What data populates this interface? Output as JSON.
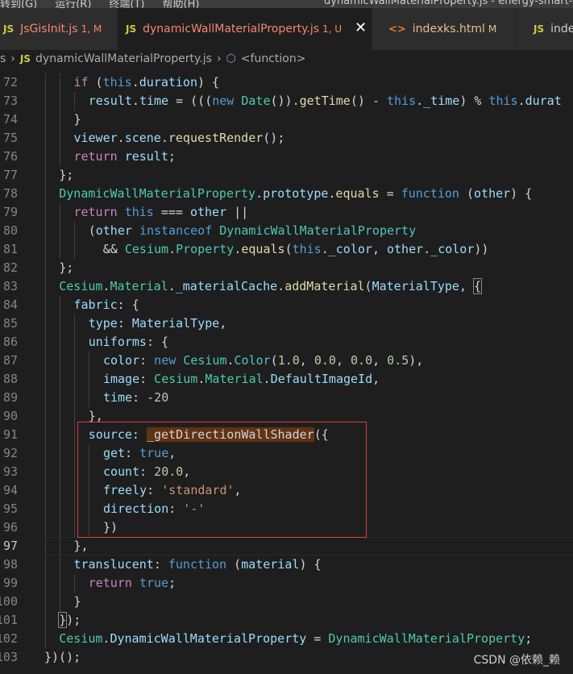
{
  "menubar": {
    "items": [
      "转到(G)",
      "运行(R)",
      "终端(T)",
      "帮助(H)"
    ],
    "window_title": "dynamicWallMaterialProperty.js - energy-smart-s"
  },
  "tabs": [
    {
      "icon": "JS",
      "name": "JsGisInit.js",
      "badge": "1, M",
      "state": "error"
    },
    {
      "icon": "JS",
      "name": "dynamicWallMaterialProperty.js",
      "badge": "1, U",
      "state": "active"
    },
    {
      "icon": "<>",
      "name": "indexks.html",
      "badge": "M",
      "state": "modified"
    },
    {
      "icon": "JS",
      "name": "inde",
      "badge": "",
      "state": "normal"
    }
  ],
  "breadcrumb": {
    "parts": [
      "s",
      "dynamicWallMaterialProperty.js",
      "<function>"
    ],
    "js_icon": "JS"
  },
  "code_lines": [
    {
      "n": "72",
      "indent": [
        1,
        2
      ],
      "tokens": [
        [
          "t-ctl",
          "if"
        ],
        [
          "t-p",
          " ("
        ],
        [
          "t-kw",
          "this"
        ],
        [
          "t-p",
          "."
        ],
        [
          "t-var",
          "duration"
        ],
        [
          "t-p",
          ") {"
        ]
      ]
    },
    {
      "n": "73",
      "indent": [
        1,
        2,
        3
      ],
      "tokens": [
        [
          "t-var",
          "result"
        ],
        [
          "t-p",
          "."
        ],
        [
          "t-var",
          "time"
        ],
        [
          "t-p",
          " = ((("
        ],
        [
          "t-kw",
          "new"
        ],
        [
          "t-p",
          " "
        ],
        [
          "t-cls",
          "Date"
        ],
        [
          "t-p",
          "())."
        ],
        [
          "t-fn",
          "getTime"
        ],
        [
          "t-p",
          "() - "
        ],
        [
          "t-kw",
          "this"
        ],
        [
          "t-p",
          "."
        ],
        [
          "t-var",
          "_time"
        ],
        [
          "t-p",
          ") % "
        ],
        [
          "t-kw",
          "this"
        ],
        [
          "t-p",
          "."
        ],
        [
          "t-var",
          "durat"
        ]
      ]
    },
    {
      "n": "74",
      "indent": [
        1,
        2
      ],
      "tokens": [
        [
          "t-p",
          "}"
        ]
      ]
    },
    {
      "n": "75",
      "indent": [
        1,
        2
      ],
      "tokens": [
        [
          "t-var",
          "viewer"
        ],
        [
          "t-p",
          "."
        ],
        [
          "t-var",
          "scene"
        ],
        [
          "t-p",
          "."
        ],
        [
          "t-fn",
          "requestRender"
        ],
        [
          "t-p",
          "();"
        ]
      ]
    },
    {
      "n": "76",
      "indent": [
        1,
        2
      ],
      "tokens": [
        [
          "t-ctl",
          "return"
        ],
        [
          "t-p",
          " "
        ],
        [
          "t-var",
          "result"
        ],
        [
          "t-p",
          ";"
        ]
      ]
    },
    {
      "n": "77",
      "indent": [
        1
      ],
      "tokens": [
        [
          "t-p",
          "};"
        ]
      ]
    },
    {
      "n": "78",
      "indent": [
        1
      ],
      "tokens": [
        [
          "t-cls",
          "DynamicWallMaterialProperty"
        ],
        [
          "t-p",
          "."
        ],
        [
          "t-var",
          "prototype"
        ],
        [
          "t-p",
          "."
        ],
        [
          "t-fn",
          "equals"
        ],
        [
          "t-p",
          " = "
        ],
        [
          "t-kw",
          "function"
        ],
        [
          "t-p",
          " ("
        ],
        [
          "t-var",
          "other"
        ],
        [
          "t-p",
          ") {"
        ]
      ]
    },
    {
      "n": "79",
      "indent": [
        1,
        2
      ],
      "tokens": [
        [
          "t-ctl",
          "return"
        ],
        [
          "t-p",
          " "
        ],
        [
          "t-kw",
          "this"
        ],
        [
          "t-p",
          " === "
        ],
        [
          "t-var",
          "other"
        ],
        [
          "t-p",
          " ||"
        ]
      ]
    },
    {
      "n": "80",
      "indent": [
        1,
        2,
        3
      ],
      "tokens": [
        [
          "t-p",
          "("
        ],
        [
          "t-var",
          "other"
        ],
        [
          "t-p",
          " "
        ],
        [
          "t-kw",
          "instanceof"
        ],
        [
          "t-p",
          " "
        ],
        [
          "t-cls",
          "DynamicWallMaterialProperty"
        ]
      ]
    },
    {
      "n": "81",
      "indent": [
        1,
        2,
        3
      ],
      "tokens": [
        [
          "t-p",
          "  && "
        ],
        [
          "t-cls",
          "Cesium"
        ],
        [
          "t-p",
          "."
        ],
        [
          "t-cls",
          "Property"
        ],
        [
          "t-p",
          "."
        ],
        [
          "t-fn",
          "equals"
        ],
        [
          "t-p",
          "("
        ],
        [
          "t-kw",
          "this"
        ],
        [
          "t-p",
          "."
        ],
        [
          "t-var",
          "_color"
        ],
        [
          "t-p",
          ", "
        ],
        [
          "t-var",
          "other"
        ],
        [
          "t-p",
          "."
        ],
        [
          "t-var",
          "_color"
        ],
        [
          "t-p",
          "))"
        ]
      ]
    },
    {
      "n": "82",
      "indent": [
        1
      ],
      "tokens": [
        [
          "t-p",
          "};"
        ]
      ]
    },
    {
      "n": "83",
      "indent": [
        1
      ],
      "tokens": [
        [
          "t-cls",
          "Cesium"
        ],
        [
          "t-p",
          "."
        ],
        [
          "t-cls",
          "Material"
        ],
        [
          "t-p",
          "."
        ],
        [
          "t-var",
          "_materialCache"
        ],
        [
          "t-p",
          "."
        ],
        [
          "t-fn",
          "addMaterial"
        ],
        [
          "t-p",
          "("
        ],
        [
          "t-var",
          "MaterialType"
        ],
        [
          "t-p",
          ", "
        ],
        [
          "t-br",
          "{"
        ]
      ]
    },
    {
      "n": "84",
      "indent": [
        1,
        2
      ],
      "tokens": [
        [
          "t-var",
          "fabric"
        ],
        [
          "t-p",
          ": {"
        ]
      ]
    },
    {
      "n": "85",
      "indent": [
        1,
        2,
        3
      ],
      "tokens": [
        [
          "t-var",
          "type"
        ],
        [
          "t-p",
          ": "
        ],
        [
          "t-var",
          "MaterialType"
        ],
        [
          "t-p",
          ","
        ]
      ]
    },
    {
      "n": "86",
      "indent": [
        1,
        2,
        3
      ],
      "tokens": [
        [
          "t-var",
          "uniforms"
        ],
        [
          "t-p",
          ": {"
        ]
      ]
    },
    {
      "n": "87",
      "indent": [
        1,
        2,
        3,
        4
      ],
      "tokens": [
        [
          "t-var",
          "color"
        ],
        [
          "t-p",
          ": "
        ],
        [
          "t-kw",
          "new"
        ],
        [
          "t-p",
          " "
        ],
        [
          "t-cls",
          "Cesium"
        ],
        [
          "t-p",
          "."
        ],
        [
          "t-cls",
          "Color"
        ],
        [
          "t-p",
          "("
        ],
        [
          "t-num",
          "1.0"
        ],
        [
          "t-p",
          ", "
        ],
        [
          "t-num",
          "0.0"
        ],
        [
          "t-p",
          ", "
        ],
        [
          "t-num",
          "0.0"
        ],
        [
          "t-p",
          ", "
        ],
        [
          "t-num",
          "0.5"
        ],
        [
          "t-p",
          "),"
        ]
      ]
    },
    {
      "n": "88",
      "indent": [
        1,
        2,
        3,
        4
      ],
      "tokens": [
        [
          "t-var",
          "image"
        ],
        [
          "t-p",
          ": "
        ],
        [
          "t-cls",
          "Cesium"
        ],
        [
          "t-p",
          "."
        ],
        [
          "t-cls",
          "Material"
        ],
        [
          "t-p",
          "."
        ],
        [
          "t-var",
          "DefaultImageId"
        ],
        [
          "t-p",
          ","
        ]
      ]
    },
    {
      "n": "89",
      "indent": [
        1,
        2,
        3,
        4
      ],
      "tokens": [
        [
          "t-var",
          "time"
        ],
        [
          "t-p",
          ": -"
        ],
        [
          "t-num",
          "20"
        ]
      ]
    },
    {
      "n": "90",
      "indent": [
        1,
        2,
        3
      ],
      "tokens": [
        [
          "t-p",
          "},"
        ]
      ]
    },
    {
      "n": "91",
      "indent": [
        1,
        2,
        3
      ],
      "tokens": [
        [
          "t-var",
          "source"
        ],
        [
          "t-p",
          ": "
        ],
        [
          "t-sel",
          "_getDirectionWallShader"
        ],
        [
          "t-p",
          "({"
        ]
      ]
    },
    {
      "n": "92",
      "indent": [
        1,
        2,
        3,
        4
      ],
      "tokens": [
        [
          "t-var",
          "get"
        ],
        [
          "t-p",
          ": "
        ],
        [
          "t-kw",
          "true"
        ],
        [
          "t-p",
          ","
        ]
      ]
    },
    {
      "n": "93",
      "indent": [
        1,
        2,
        3,
        4
      ],
      "tokens": [
        [
          "t-var",
          "count"
        ],
        [
          "t-p",
          ": "
        ],
        [
          "t-num",
          "20.0"
        ],
        [
          "t-p",
          ","
        ]
      ]
    },
    {
      "n": "94",
      "indent": [
        1,
        2,
        3,
        4
      ],
      "tokens": [
        [
          "t-var",
          "freely"
        ],
        [
          "t-p",
          ": "
        ],
        [
          "t-str",
          "'standard'"
        ],
        [
          "t-p",
          ","
        ]
      ]
    },
    {
      "n": "95",
      "indent": [
        1,
        2,
        3,
        4
      ],
      "tokens": [
        [
          "t-var",
          "direction"
        ],
        [
          "t-p",
          ": "
        ],
        [
          "t-str",
          "'-'"
        ]
      ]
    },
    {
      "n": "96",
      "indent": [
        1,
        2,
        3,
        4
      ],
      "tokens": [
        [
          "t-p",
          "})"
        ]
      ]
    },
    {
      "n": "97",
      "indent": [
        1,
        2
      ],
      "current": true,
      "tokens": [
        [
          "t-p",
          "},"
        ]
      ]
    },
    {
      "n": "98",
      "indent": [
        1,
        2
      ],
      "tokens": [
        [
          "t-var",
          "translucent"
        ],
        [
          "t-p",
          ": "
        ],
        [
          "t-kw",
          "function"
        ],
        [
          "t-p",
          " ("
        ],
        [
          "t-var",
          "material"
        ],
        [
          "t-p",
          ") {"
        ]
      ]
    },
    {
      "n": "99",
      "indent": [
        1,
        2,
        3
      ],
      "tokens": [
        [
          "t-ctl",
          "return"
        ],
        [
          "t-p",
          " "
        ],
        [
          "t-kw",
          "true"
        ],
        [
          "t-p",
          ";"
        ]
      ]
    },
    {
      "n": "100",
      "indent": [
        1,
        2
      ],
      "tokens": [
        [
          "t-p",
          "}"
        ]
      ]
    },
    {
      "n": "101",
      "indent": [
        1
      ],
      "tokens": [
        [
          "t-br",
          "}"
        ],
        [
          "t-p",
          ");"
        ]
      ]
    },
    {
      "n": "102",
      "indent": [
        1
      ],
      "tokens": [
        [
          "t-cls",
          "Cesium"
        ],
        [
          "t-p",
          "."
        ],
        [
          "t-var",
          "DynamicWallMaterialProperty"
        ],
        [
          "t-p",
          " = "
        ],
        [
          "t-cls",
          "DynamicWallMaterialProperty"
        ],
        [
          "t-p",
          ";"
        ]
      ]
    },
    {
      "n": "103",
      "indent": [],
      "tokens": [
        [
          "t-p",
          "})();"
        ]
      ]
    }
  ],
  "watermark": "CSDN @依赖_赖",
  "colors": {
    "editor_bg": "#1e1e1e",
    "highlight_box": "#e03c3c",
    "selection": "#613214"
  }
}
